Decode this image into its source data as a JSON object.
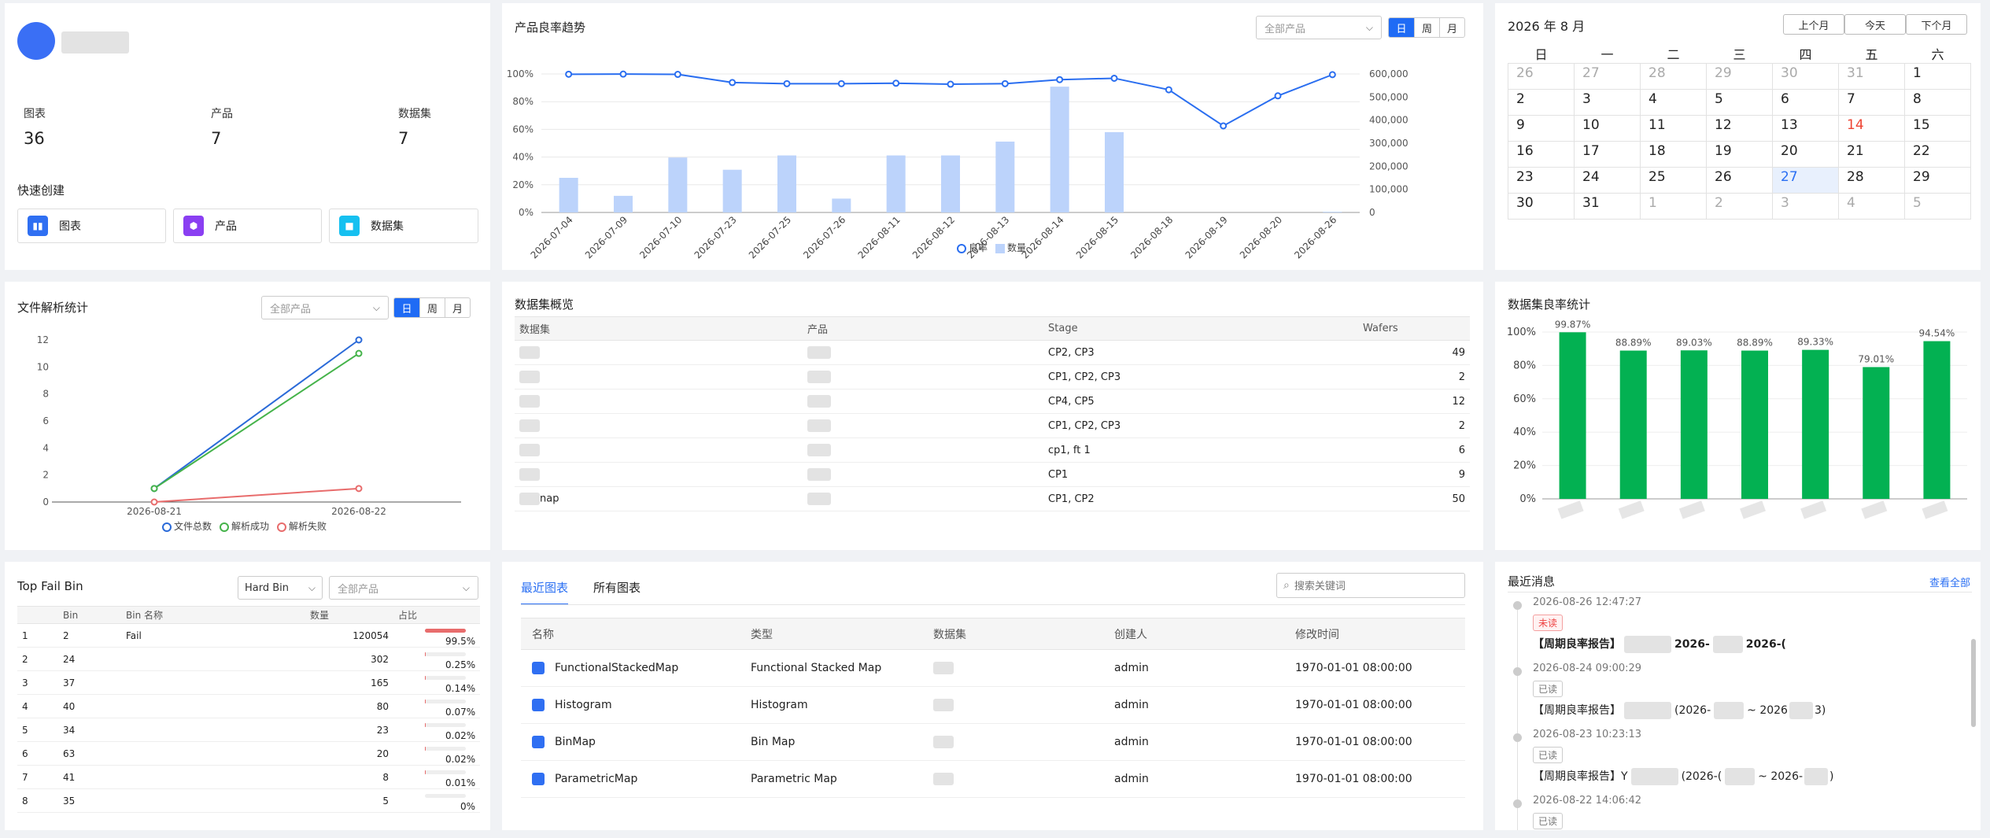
{
  "user": {
    "avatar_color": "#3a6ff5"
  },
  "stats": [
    {
      "label": "图表",
      "value": "36"
    },
    {
      "label": "产品",
      "value": "7"
    },
    {
      "label": "数据集",
      "value": "7"
    }
  ],
  "quick_create": {
    "title": "快速创建",
    "items": [
      {
        "label": "图表",
        "color": "#2f6ff2",
        "icon": "chart-icon"
      },
      {
        "label": "产品",
        "color": "#8a3ff2",
        "icon": "product-icon"
      },
      {
        "label": "数据集",
        "color": "#16c0f0",
        "icon": "dataset-icon"
      }
    ]
  },
  "yield_trend": {
    "title": "产品良率趋势",
    "product_select": "全部产品",
    "toggles": [
      "日",
      "周",
      "月"
    ],
    "active_toggle": "日",
    "legend": [
      "良率",
      "数量"
    ],
    "chart_data": {
      "type": "line+bar",
      "categories": [
        "2026-07-04",
        "2026-07-09",
        "2026-07-10",
        "2026-07-23",
        "2026-07-25",
        "2026-07-26",
        "2026-08-11",
        "2026-08-12",
        "2026-08-13",
        "2026-08-14",
        "2026-08-15",
        "2026-08-18",
        "2026-08-19",
        "2026-08-20",
        "2026-08-26"
      ],
      "series": [
        {
          "name": "良率",
          "type": "line",
          "axis": "left",
          "values": [
            99.8,
            99.9,
            99.7,
            93.8,
            93.0,
            93.0,
            93.3,
            92.6,
            93.0,
            95.9,
            96.9,
            88.6,
            62.5,
            84.2,
            99.5
          ]
        },
        {
          "name": "数量",
          "type": "bar",
          "axis": "right",
          "values": [
            150000,
            72000,
            238000,
            185000,
            247000,
            60000,
            247000,
            247000,
            307000,
            545000,
            348000,
            0,
            0,
            0,
            3000
          ]
        }
      ],
      "y_left": {
        "ticks": [
          "0%",
          "20%",
          "40%",
          "60%",
          "80%",
          "100%"
        ],
        "range": [
          0,
          100
        ]
      },
      "y_right": {
        "ticks": [
          "0",
          "100,000",
          "200,000",
          "300,000",
          "400,000",
          "500,000",
          "600,000"
        ],
        "range": [
          0,
          600000
        ]
      }
    }
  },
  "calendar": {
    "title": "2026 年 8 月",
    "buttons": [
      "上个月",
      "今天",
      "下个月"
    ],
    "weekdays": [
      "日",
      "一",
      "二",
      "三",
      "四",
      "五",
      "六"
    ],
    "weeks": [
      [
        "26",
        "27",
        "28",
        "29",
        "30",
        "31",
        "1"
      ],
      [
        "2",
        "3",
        "4",
        "5",
        "6",
        "7",
        "8"
      ],
      [
        "9",
        "10",
        "11",
        "12",
        "13",
        "14",
        "15"
      ],
      [
        "16",
        "17",
        "18",
        "19",
        "20",
        "21",
        "22"
      ],
      [
        "23",
        "24",
        "25",
        "26",
        "27",
        "28",
        "29"
      ],
      [
        "30",
        "31",
        "1",
        "2",
        "3",
        "4",
        "5"
      ]
    ],
    "today": "27"
  },
  "file_stats": {
    "title": "文件解析统计",
    "product_select": "全部产品",
    "toggles": [
      "日",
      "周",
      "月"
    ],
    "active_toggle": "日",
    "legend": [
      {
        "label": "文件总数",
        "color": "#2a6ad8"
      },
      {
        "label": "解析成功",
        "color": "#45b34a"
      },
      {
        "label": "解析失败",
        "color": "#e86c6c"
      }
    ],
    "chart_data": {
      "type": "line",
      "x": [
        "2026-08-21",
        "2026-08-22"
      ],
      "series": [
        {
          "name": "文件总数",
          "values": [
            1,
            12
          ]
        },
        {
          "name": "解析成功",
          "values": [
            1,
            11
          ]
        },
        {
          "name": "解析失败",
          "values": [
            0,
            1
          ]
        }
      ],
      "y_ticks": [
        "0",
        "2",
        "4",
        "6",
        "8",
        "10",
        "12"
      ],
      "ylim": [
        0,
        12
      ]
    }
  },
  "dataset_overview": {
    "title": "数据集概览",
    "columns": [
      "数据集",
      "产品",
      "Stage",
      "Wafers"
    ],
    "rows": [
      {
        "dataset": "",
        "product": "",
        "stage": "CP2, CP3",
        "wafers": "49"
      },
      {
        "dataset": "",
        "product": "",
        "stage": "CP1, CP2, CP3",
        "wafers": "2"
      },
      {
        "dataset": "",
        "product": "",
        "stage": "CP4, CP5",
        "wafers": "12"
      },
      {
        "dataset": "",
        "product": "",
        "stage": "CP1, CP2, CP3",
        "wafers": "2"
      },
      {
        "dataset": "",
        "product": "",
        "stage": "cp1, ft 1",
        "wafers": "6"
      },
      {
        "dataset": "",
        "product": "",
        "stage": "CP1",
        "wafers": "9"
      },
      {
        "dataset": "nap",
        "product": "",
        "stage": "CP1, CP2",
        "wafers": "50"
      }
    ]
  },
  "dataset_yield": {
    "title": "数据集良率统计",
    "chart_data": {
      "type": "bar",
      "categories": [
        "",
        "",
        "",
        "",
        "",
        "",
        ""
      ],
      "values": [
        99.87,
        88.89,
        89.03,
        88.89,
        89.33,
        79.01,
        94.54
      ],
      "value_labels": [
        "99.87%",
        "88.89%",
        "89.03%",
        "88.89%",
        "89.33%",
        "79.01%",
        "94.54%"
      ],
      "y_ticks": [
        "0%",
        "20%",
        "40%",
        "60%",
        "80%",
        "100%"
      ],
      "ylim": [
        0,
        100
      ],
      "color": "#03b152"
    }
  },
  "top_fail": {
    "title": "Top Fail Bin",
    "bin_select": "Hard Bin",
    "product_select": "全部产品",
    "columns": [
      "Bin",
      "Bin 名称",
      "数量",
      "占比"
    ],
    "rows": [
      {
        "rank": "1",
        "bin": "2",
        "name": "Fail",
        "count": "120054",
        "pct": "99.5%",
        "ratio": 0.995
      },
      {
        "rank": "2",
        "bin": "24",
        "name": "",
        "count": "302",
        "pct": "0.25%",
        "ratio": 0.0025
      },
      {
        "rank": "3",
        "bin": "37",
        "name": "",
        "count": "165",
        "pct": "0.14%",
        "ratio": 0.0014
      },
      {
        "rank": "4",
        "bin": "40",
        "name": "",
        "count": "80",
        "pct": "0.07%",
        "ratio": 0.0007
      },
      {
        "rank": "5",
        "bin": "34",
        "name": "",
        "count": "23",
        "pct": "0.02%",
        "ratio": 0.0002
      },
      {
        "rank": "6",
        "bin": "63",
        "name": "",
        "count": "20",
        "pct": "0.02%",
        "ratio": 0.0002
      },
      {
        "rank": "7",
        "bin": "41",
        "name": "",
        "count": "8",
        "pct": "0.01%",
        "ratio": 0.0001
      },
      {
        "rank": "8",
        "bin": "35",
        "name": "",
        "count": "5",
        "pct": "0%",
        "ratio": 0
      }
    ]
  },
  "charts_panel": {
    "tabs": [
      "最近图表",
      "所有图表"
    ],
    "search_placeholder": "搜索关键词",
    "columns": [
      "名称",
      "类型",
      "数据集",
      "创建人",
      "修改时间"
    ],
    "rows": [
      {
        "name": "FunctionalStackedMap",
        "type": "Functional Stacked Map",
        "dataset": "",
        "creator": "admin",
        "modified": "1970-01-01 08:00:00"
      },
      {
        "name": "Histogram",
        "type": "Histogram",
        "dataset": "",
        "creator": "admin",
        "modified": "1970-01-01 08:00:00"
      },
      {
        "name": "BinMap",
        "type": "Bin Map",
        "dataset": "",
        "creator": "admin",
        "modified": "1970-01-01 08:00:00"
      },
      {
        "name": "ParametricMap",
        "type": "Parametric Map",
        "dataset": "",
        "creator": "admin",
        "modified": "1970-01-01 08:00:00"
      }
    ]
  },
  "messages": {
    "title": "最近消息",
    "view_all": "查看全部",
    "items": [
      {
        "time": "2026-08-26 12:47:27",
        "status": "未读",
        "unread": true,
        "text": "【周期良率报告】",
        "t2": "2026-",
        "t3": "2026-("
      },
      {
        "time": "2026-08-24 09:00:29",
        "status": "已读",
        "unread": false,
        "text": "【周期良率报告】",
        "t2": "(2026-",
        "t3": "~ 2026",
        "t4": "3)"
      },
      {
        "time": "2026-08-23 10:23:13",
        "status": "已读",
        "unread": false,
        "text": "【周期良率报告】Y",
        "t2": "(2026-(",
        "t3": "~ 2026-",
        "t4": ")"
      },
      {
        "time": "2026-08-22 14:06:42",
        "status": "已读",
        "unread": false,
        "text": "",
        "t2": "",
        "t3": "",
        "t4": ""
      }
    ]
  }
}
